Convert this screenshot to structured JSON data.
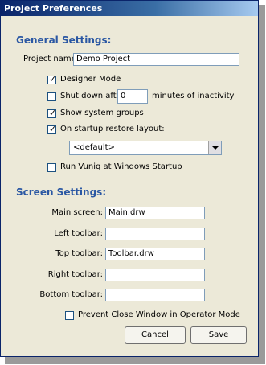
{
  "window": {
    "title": "Project Preferences"
  },
  "general": {
    "heading": "General Settings:",
    "project_name_label": "Project name:",
    "project_name_value": "Demo Project",
    "designer_mode": {
      "label": "Designer Mode",
      "checked": true
    },
    "shutdown": {
      "label_before": "Shut down after",
      "value": "0",
      "label_after": "minutes of inactivity",
      "checked": false
    },
    "system_groups": {
      "label": "Show system groups",
      "checked": true
    },
    "restore_layout": {
      "label": "On startup restore layout:",
      "checked": true
    },
    "layout_select": {
      "selected": "<default>"
    },
    "run_at_startup": {
      "label": "Run Vuniq at Windows Startup",
      "checked": false
    }
  },
  "screen": {
    "heading": "Screen Settings:",
    "main_label": "Main screen:",
    "main_value": "Main.drw",
    "left_label": "Left toolbar:",
    "left_value": "",
    "top_label": "Top toolbar:",
    "top_value": "Toolbar.drw",
    "right_label": "Right toolbar:",
    "right_value": "",
    "bottom_label": "Bottom toolbar:",
    "bottom_value": "",
    "prevent_close": {
      "label": "Prevent Close Window in Operator Mode",
      "checked": false
    }
  },
  "buttons": {
    "cancel": "Cancel",
    "save": "Save"
  }
}
